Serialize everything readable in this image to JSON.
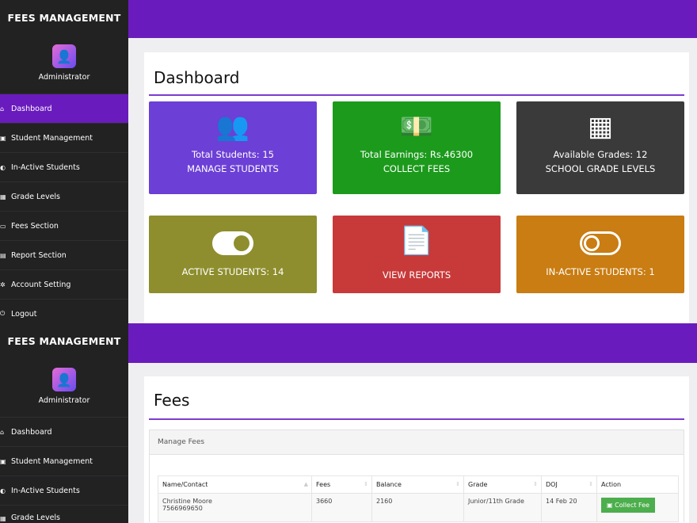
{
  "sidebar": {
    "title": "FEES MANAGEMENT",
    "user": "Administrator",
    "items": [
      {
        "label": "Dashboard",
        "icon": "⌂"
      },
      {
        "label": "Student Management",
        "icon": "▣"
      },
      {
        "label": "In-Active Students",
        "icon": "◐"
      },
      {
        "label": "Grade Levels",
        "icon": "▦"
      },
      {
        "label": "Fees Section",
        "icon": "▭"
      },
      {
        "label": "Report Section",
        "icon": "▤"
      },
      {
        "label": "Account Setting",
        "icon": "✲"
      },
      {
        "label": "Logout",
        "icon": "⏻"
      }
    ]
  },
  "dashboard": {
    "title": "Dashboard",
    "cards": [
      {
        "line1": "Total Students: 15",
        "line2": "MANAGE STUDENTS",
        "icon": "users-icon",
        "color": "#6c3fd6"
      },
      {
        "line1": "Total Earnings: Rs.46300",
        "line2": "COLLECT FEES",
        "icon": "money-icon",
        "color": "#1c9a1c"
      },
      {
        "line1": "Available Grades: 12",
        "line2": "SCHOOL GRADE LEVELS",
        "icon": "grid-icon",
        "color": "#3a3a3a"
      },
      {
        "line1": "ACTIVE STUDENTS: 14",
        "icon": "toggle-on-icon",
        "color": "#8e8e2e"
      },
      {
        "line1": "VIEW REPORTS",
        "icon": "pdf-icon",
        "color": "#c83a3a"
      },
      {
        "line1": "IN-ACTIVE STUDENTS: 1",
        "icon": "toggle-off-icon",
        "color": "#c97d12"
      }
    ]
  },
  "fees": {
    "title": "Fees",
    "box_title": "Manage Fees",
    "columns": [
      "Name/Contact",
      "Fees",
      "Balance",
      "Grade",
      "DOJ",
      "Action"
    ],
    "rows": [
      {
        "name": "Christine Moore",
        "contact": "7566969650",
        "fees": "3660",
        "balance": "2160",
        "grade": "Junior/11th Grade",
        "doj": "14 Feb 20",
        "action": "Collect Fee"
      }
    ]
  }
}
